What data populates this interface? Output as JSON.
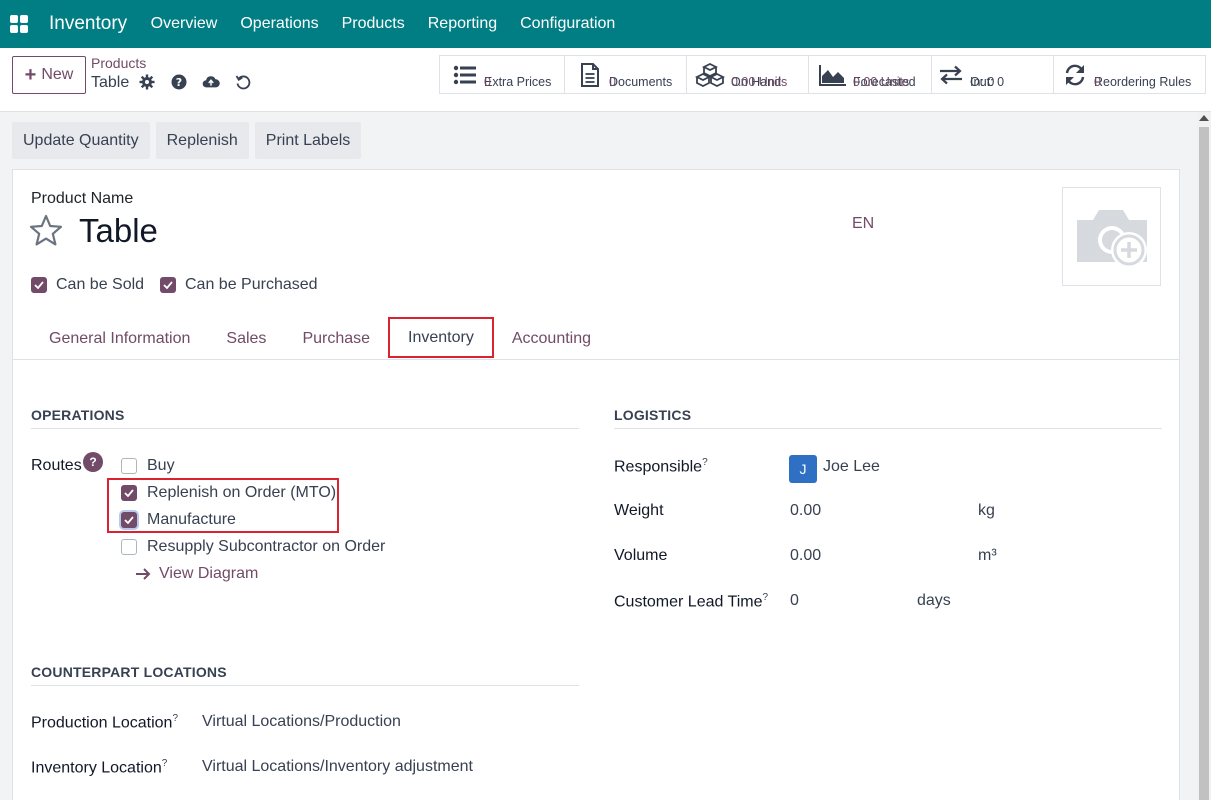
{
  "navbar": {
    "apps_icon": "apps-grid-icon",
    "brand": "Inventory",
    "menu": [
      "Overview",
      "Operations",
      "Products",
      "Reporting",
      "Configuration"
    ]
  },
  "control": {
    "new_label": "New",
    "breadcrumb_parent": "Products",
    "breadcrumb_current": "Table",
    "icons": [
      "gear-icon",
      "help-icon",
      "cloud-save-icon",
      "discard-icon"
    ]
  },
  "stats": [
    {
      "label": "Extra Prices",
      "value": "0",
      "icon": "list-icon"
    },
    {
      "label": "Documents",
      "value": "0",
      "icon": "document-icon"
    },
    {
      "label": "On Hand",
      "value": "0.00 Units",
      "icon": "cubes-icon"
    },
    {
      "label": "Forecasted",
      "value": "0.00 Units",
      "icon": "area-chart-icon"
    },
    {
      "label": "In: 0",
      "value": "Out: 0",
      "icon": "exchange-icon"
    },
    {
      "label": "Reordering Rules",
      "value": "0",
      "icon": "refresh-icon"
    }
  ],
  "actions": [
    "Update Quantity",
    "Replenish",
    "Print Labels"
  ],
  "product": {
    "name_label": "Product Name",
    "name": "Table",
    "lang": "EN",
    "can_be_sold": "Can be Sold",
    "can_be_purchased": "Can be Purchased"
  },
  "tabs": [
    "General Information",
    "Sales",
    "Purchase",
    "Inventory",
    "Accounting"
  ],
  "active_tab": "Inventory",
  "operations": {
    "title": "OPERATIONS",
    "routes_label": "Routes",
    "help_mark": "?",
    "routes": [
      {
        "label": "Buy",
        "checked": false
      },
      {
        "label": "Replenish on Order (MTO)",
        "checked": true
      },
      {
        "label": "Manufacture",
        "checked": true
      },
      {
        "label": "Resupply Subcontractor on Order",
        "checked": false
      }
    ],
    "view_diagram": "View Diagram"
  },
  "logistics": {
    "title": "LOGISTICS",
    "responsible_label": "Responsible",
    "responsible_initial": "J",
    "responsible_name": "Joe Lee",
    "weight_label": "Weight",
    "weight_value": "0.00",
    "weight_unit": "kg",
    "volume_label": "Volume",
    "volume_value": "0.00",
    "volume_unit": "m³",
    "lead_label": "Customer Lead Time",
    "lead_value": "0",
    "lead_unit": "days",
    "help_sup": "?"
  },
  "counterpart": {
    "title": "COUNTERPART LOCATIONS",
    "production_label": "Production Location",
    "production_value": "Virtual Locations/Production",
    "inventory_label": "Inventory Location",
    "inventory_value": "Virtual Locations/Inventory adjustment",
    "help_sup": "?"
  },
  "colors": {
    "navbar": "#017e84",
    "accent": "#714b67",
    "highlight": "#d9232e"
  }
}
